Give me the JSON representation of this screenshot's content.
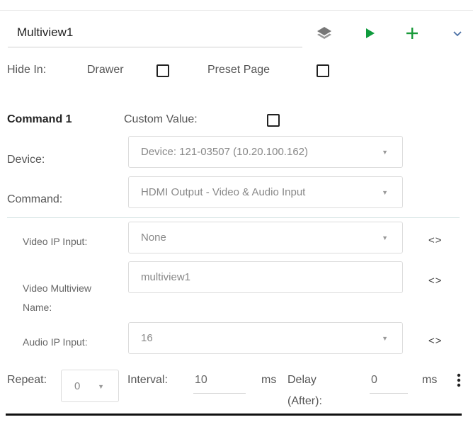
{
  "header": {
    "name_value": "Multiview1",
    "icons": [
      "layers-icon",
      "play-icon",
      "plus-icon",
      "chevron-down-icon"
    ],
    "colors": {
      "play": "#0f9b3d",
      "plus": "#1a9a3a",
      "chevron": "#4a6fa5"
    }
  },
  "hide_in": {
    "label": "Hide In:",
    "drawer_label": "Drawer",
    "preset_label": "Preset Page"
  },
  "command": {
    "title": "Command 1",
    "custom_value_label": "Custom Value:",
    "device_label": "Device:",
    "device_value": "Device: 121-03507 (10.20.100.162)",
    "command_label": "Command:",
    "command_value": "HDMI Output - Video & Audio Input"
  },
  "params": {
    "video_ip_label": "Video IP Input:",
    "video_ip_value": "None",
    "multiview_label_1": "Video Multiview",
    "multiview_label_2": "Name:",
    "multiview_value": "multiview1",
    "audio_ip_label": "Audio IP Input:",
    "audio_ip_value": "16",
    "code_glyph": "<>"
  },
  "footer": {
    "repeat_label": "Repeat:",
    "repeat_value": "0",
    "interval_label": "Interval:",
    "interval_value": "10",
    "interval_unit": "ms",
    "delay_label_1": "Delay",
    "delay_label_2": "(After):",
    "delay_value": "0",
    "delay_unit": "ms"
  }
}
